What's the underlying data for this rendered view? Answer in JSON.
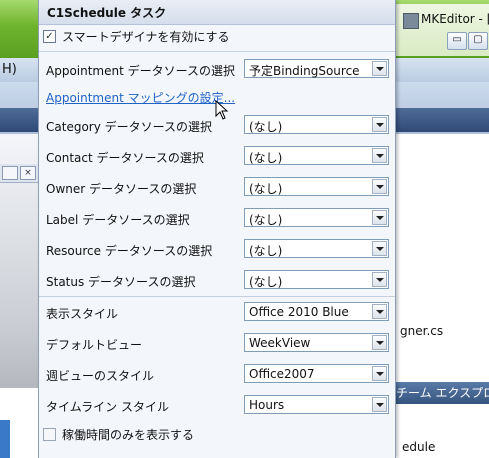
{
  "background": {
    "menu_left": "H)",
    "window_title": "MKEditor - [C",
    "win_buttons": [
      "▭",
      "▢",
      "✕"
    ],
    "left_tabs": [
      "×"
    ],
    "file_name": "gner.cs",
    "explorer_title": "チーム エクスプロ",
    "schedule_text": "edule"
  },
  "panel": {
    "title": "C1Schedule タスク",
    "smart_designer": {
      "label": "スマートデザイナを有効にする",
      "checked": true
    },
    "appointment_source": {
      "label": "Appointment データソースの選択",
      "value": "予定BindingSource"
    },
    "mapping_link": "Appointment マッピングの設定...",
    "category_source": {
      "label": "Category データソースの選択",
      "value": "(なし)"
    },
    "contact_source": {
      "label": "Contact データソースの選択",
      "value": "(なし)"
    },
    "owner_source": {
      "label": "Owner データソースの選択",
      "value": "(なし)"
    },
    "label_source": {
      "label": "Label データソースの選択",
      "value": "(なし)"
    },
    "resource_source": {
      "label": "Resource データソースの選択",
      "value": "(なし)"
    },
    "status_source": {
      "label": "Status データソースの選択",
      "value": "(なし)"
    },
    "display_style": {
      "label": "表示スタイル",
      "value": "Office 2010 Blue"
    },
    "default_view": {
      "label": "デフォルトビュー",
      "value": "WeekView"
    },
    "week_view_style": {
      "label": "週ビューのスタイル",
      "value": "Office2007"
    },
    "timeline_style": {
      "label": "タイムライン スタイル",
      "value": "Hours"
    },
    "working_hours_only": {
      "label": "稼働時間のみを表示する",
      "checked": false
    }
  },
  "colors": {
    "link": "#1f63c6",
    "accent_green": "#6fb42d"
  }
}
